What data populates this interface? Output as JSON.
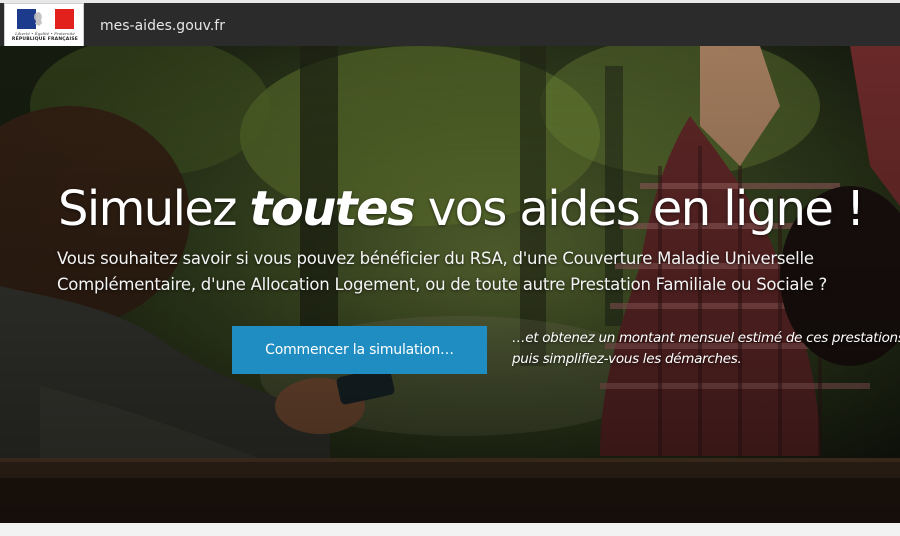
{
  "header": {
    "logo": {
      "motto": "Liberté • Égalité • Fraternité",
      "republic": "RÉPUBLIQUE FRANÇAISE",
      "flag_colors": [
        "#1d3b8c",
        "#ffffff",
        "#e2211c"
      ]
    },
    "site_name": "mes-aides.gouv.fr"
  },
  "hero": {
    "headline_before": "Simulez ",
    "headline_emphasis": "toutes",
    "headline_after": " vos aides en ligne !",
    "lead_line1": "Vous souhaitez savoir si vous pouvez bénéficier du RSA, d'une Couverture Maladie Universelle",
    "lead_line2": "Complémentaire, d'une Allocation Logement, ou de toute autre Prestation Familiale ou Sociale ?",
    "cta_label": "Commencer la simulation…",
    "aside_line1": "…et obtenez un montant mensuel estimé de ces prestations,",
    "aside_line2": "puis simplifiez-vous les démarches."
  },
  "colors": {
    "navbar": "#2b2b2b",
    "cta": "#1f8dc1",
    "text": "#ffffff"
  }
}
